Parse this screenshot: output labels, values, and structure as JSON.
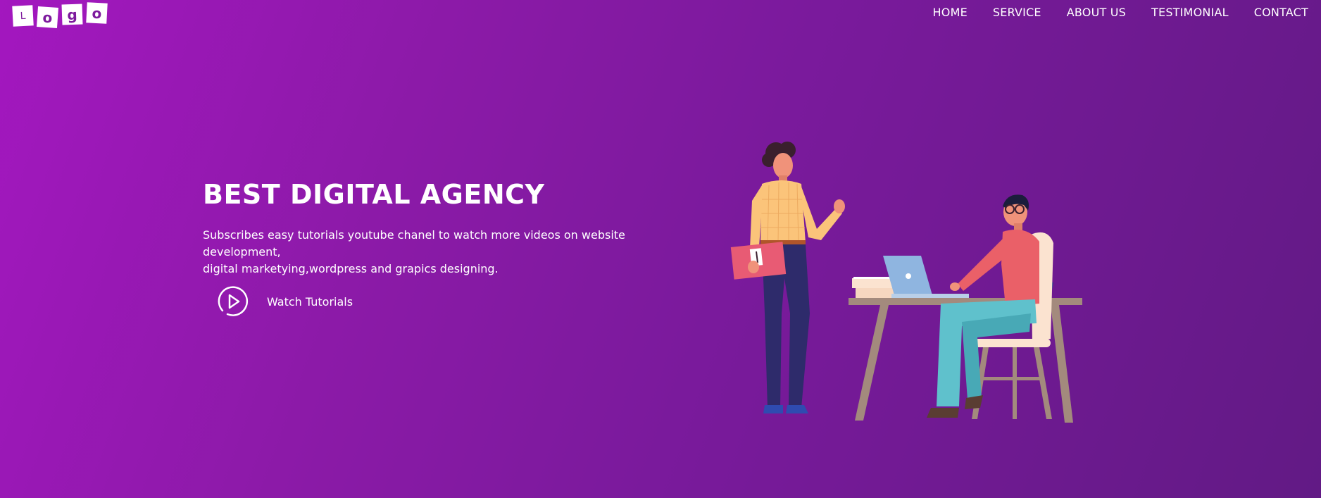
{
  "logo": {
    "letters": [
      "L",
      "o",
      "g",
      "o"
    ]
  },
  "nav": {
    "items": [
      "HOME",
      "SERVICE",
      "ABOUT US",
      "TESTIMONIAL",
      "CONTACT"
    ]
  },
  "hero": {
    "title": "BEST DIGITAL AGENCY",
    "description_line1": "Subscribes easy tutorials youtube chanel to watch more videos on website development,",
    "description_line2": "digital marketying,wordpress and grapics designing.",
    "watch_label": "Watch Tutorials",
    "play_icon": "play-circle-icon",
    "illustration": "two-people-office-desk-laptop"
  },
  "colors": {
    "gradient_start": "#a317bf",
    "gradient_end": "#621a85",
    "text": "#ffffff"
  }
}
